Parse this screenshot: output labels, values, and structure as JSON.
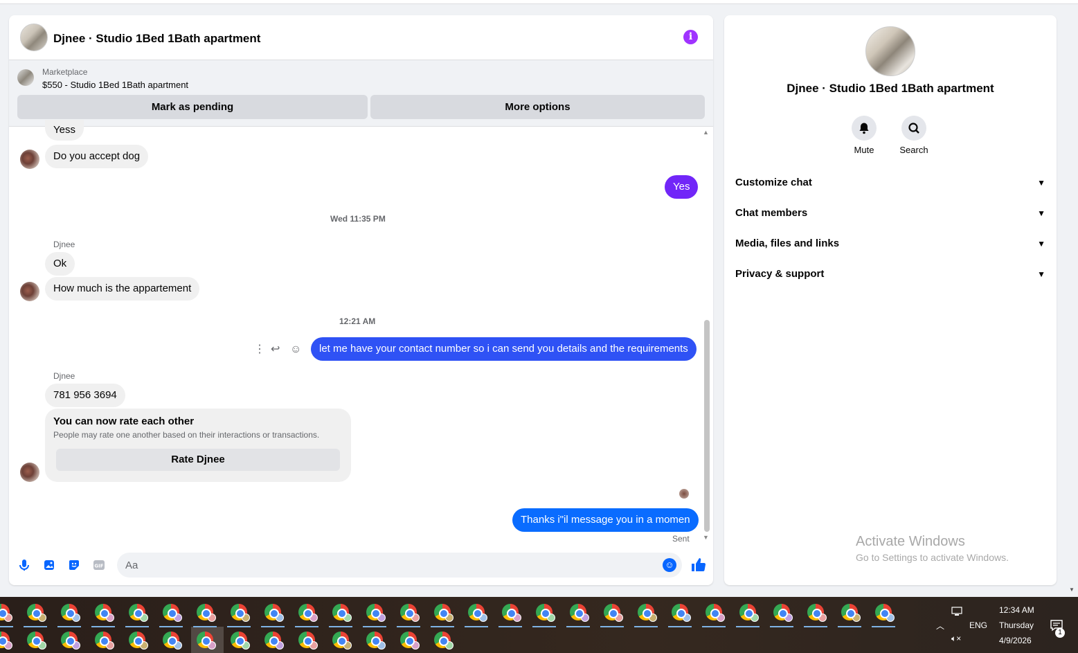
{
  "chat": {
    "title": "Djnee · Studio 1Bed 1Bath apartment",
    "marketplace_label": "Marketplace",
    "listing": "$550 - Studio 1Bed 1Bath apartment",
    "btn_pending": "Mark as pending",
    "btn_more": "More options",
    "messages": {
      "m1": "Yess",
      "m2": "Do you accept dog",
      "m3": "Yes",
      "ts1": "Wed 11:35 PM",
      "sender1": "Djnee",
      "m4": "Ok",
      "m5": "How much is the appartement",
      "ts2": "12:21 AM",
      "m6": "let me have your contact number so i can send you details and the requirements",
      "sender2": "Djnee",
      "m7": "781 956 3694",
      "rate_title": "You can now rate each other",
      "rate_sub": "People may rate one another based on their interactions or transactions.",
      "rate_btn": "Rate Djnee",
      "m8": "Thanks i\"il message you in a momen",
      "sent": "Sent"
    },
    "composer_placeholder": "Aa"
  },
  "info": {
    "name": "Djnee · Studio 1Bed 1Bath apartment",
    "mute": "Mute",
    "search": "Search",
    "sections": [
      "Customize chat",
      "Chat members",
      "Media, files and links",
      "Privacy & support"
    ]
  },
  "watermark": {
    "line1": "Activate Windows",
    "line2": "Go to Settings to activate Windows."
  },
  "taskbar": {
    "time": "12:34 AM",
    "day": "Thursday",
    "date": "4/9/2026",
    "lang": "ENG",
    "notif_count": "1"
  },
  "colors": {
    "accent_purple": "#a033ff",
    "bubble_purple": "#7126f8",
    "bubble_blue": "#0a6cff",
    "messenger_blue": "#0866ff"
  }
}
